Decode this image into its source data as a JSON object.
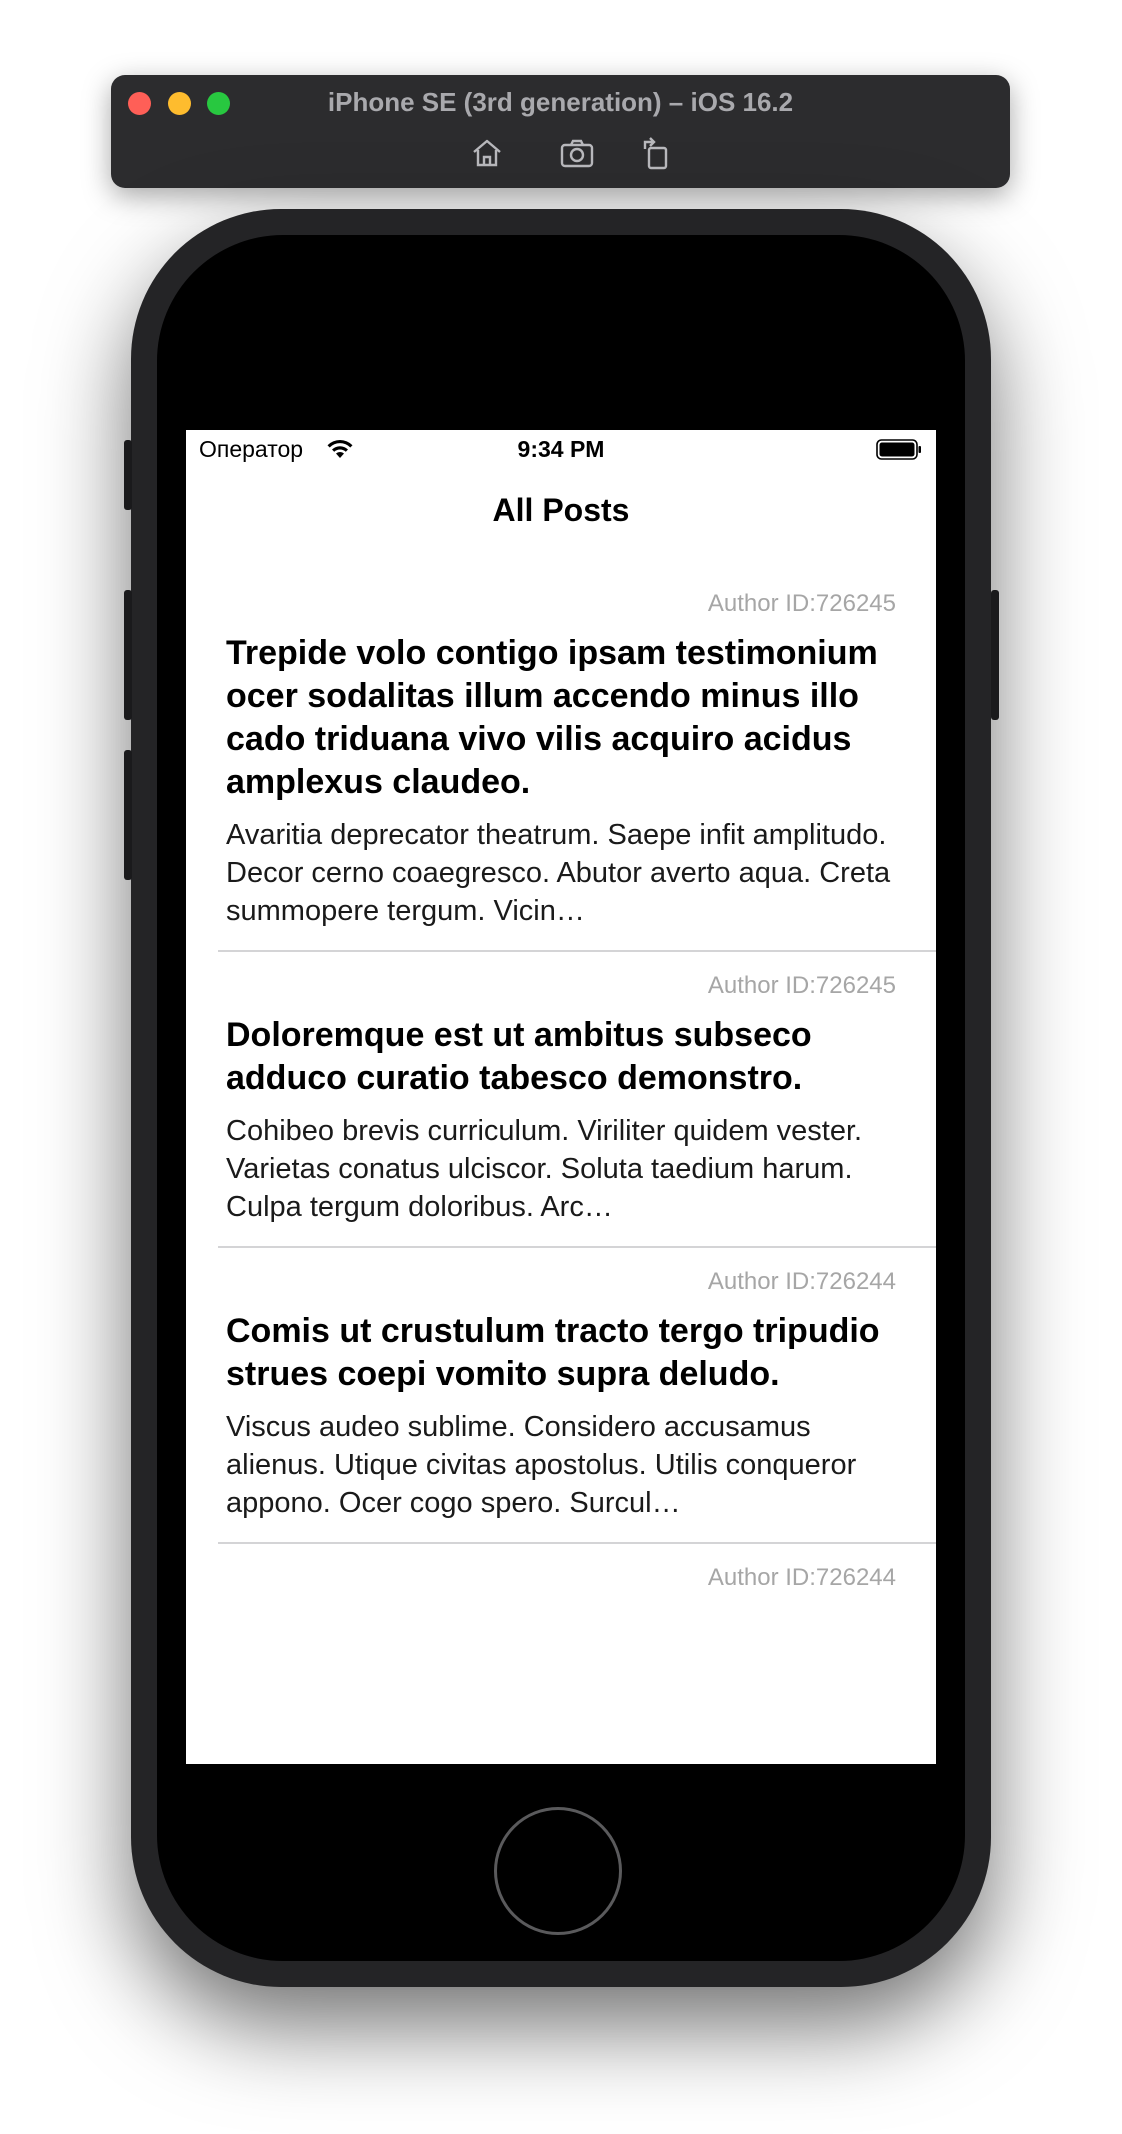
{
  "simulator": {
    "title": "iPhone SE (3rd generation) – iOS 16.2",
    "toolbar_icons": [
      "home-icon",
      "screenshot-icon",
      "rotate-icon"
    ]
  },
  "status_bar": {
    "carrier": "Оператор",
    "time": "9:34 PM"
  },
  "nav": {
    "title": "All Posts"
  },
  "posts": [
    {
      "author": "Author ID:726245",
      "title": "Trepide volo contigo ipsam testimonium ocer sodalitas illum accendo minus illo cado triduana vivo vilis acquiro acidus amplexus claudeo.",
      "body": "Avaritia deprecator theatrum. Saepe infit amplitudo. Decor cerno coaegresco. Abutor averto aqua. Creta summopere tergum. Vicin…"
    },
    {
      "author": "Author ID:726245",
      "title": "Doloremque est ut ambitus subseco adduco curatio tabesco demonstro.",
      "body": "Cohibeo brevis curriculum. Viriliter quidem vester. Varietas conatus ulciscor. Soluta taedium harum. Culpa tergum doloribus. Arc…"
    },
    {
      "author": "Author ID:726244",
      "title": "Comis ut crustulum tracto tergo tripudio strues coepi vomito supra deludo.",
      "body": "Viscus audeo sublime. Considero accusamus alienus. Utique civitas apostolus. Utilis conqueror appono. Ocer cogo spero. Surcul…"
    },
    {
      "author": "Author ID:726244",
      "title": "",
      "body": ""
    }
  ]
}
